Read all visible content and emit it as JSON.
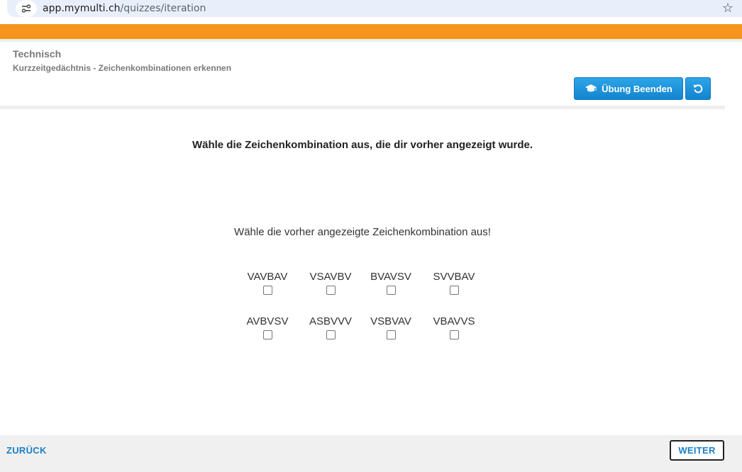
{
  "browser": {
    "url_host": "app.mymulti.ch",
    "url_path": "/quizzes/iteration"
  },
  "header": {
    "category": "Technisch",
    "subtitle": "Kurzzeitgedächtnis - Zeichenkombinationen erkennen",
    "end_button_label": "Übung Beenden",
    "end_button_icon": "graduation-cap-icon",
    "reset_icon": "rotate-ccw-icon"
  },
  "quiz": {
    "question": "Wähle die Zeichenkombination aus, die dir vorher angezeigt wurde.",
    "instruction": "Wähle die vorher angezeigte Zeichenkombination aus!",
    "options": [
      {
        "label": "VAVBAV",
        "checked": false
      },
      {
        "label": "VSAVBV",
        "checked": false
      },
      {
        "label": "BVAVSV",
        "checked": false
      },
      {
        "label": "SVVBAV",
        "checked": false
      },
      {
        "label": "AVBVSV",
        "checked": false
      },
      {
        "label": "ASBVVV",
        "checked": false
      },
      {
        "label": "VSBVAV",
        "checked": false
      },
      {
        "label": "VBAVVS",
        "checked": false
      }
    ]
  },
  "footer": {
    "back_label": "ZURÜCK",
    "next_label": "WEITER"
  },
  "colors": {
    "accent_orange": "#f7941d",
    "button_blue": "#1384cf",
    "link_blue": "#1a7fc2"
  }
}
